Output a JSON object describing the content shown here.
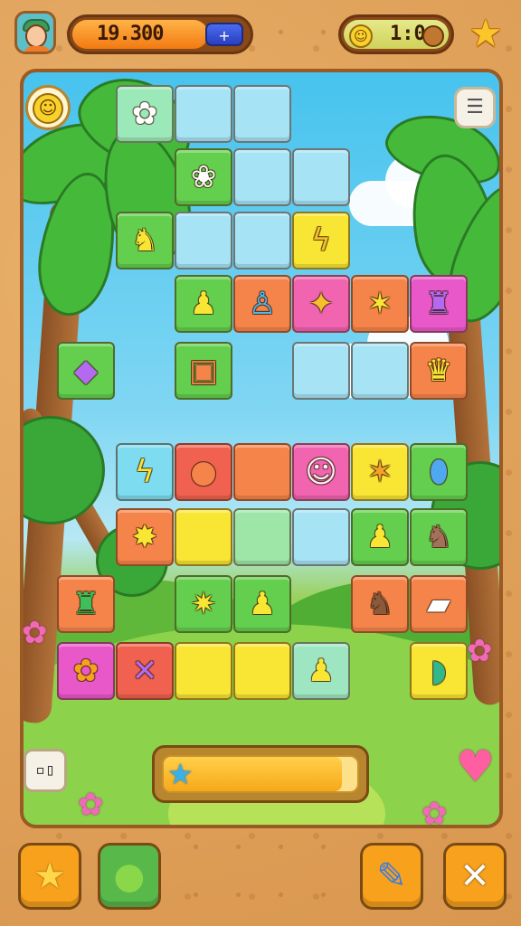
{
  "hud": {
    "score": "19.300",
    "score_add_symbol": "+",
    "timer": "1:0",
    "smile_symbol": "☺",
    "star_symbol": "★"
  },
  "controls": {
    "smiley_symbol": "☺",
    "menu_symbol": "☰",
    "tool_symbol": "▫▯",
    "progress_star_symbol": "★",
    "progress_fraction": 0.92
  },
  "bottom_bar": {
    "star_symbol": "★",
    "pet_symbol": "●",
    "pencil_symbol": "✎",
    "close_symbol": "✕"
  },
  "board": {
    "colors": {
      "green": "#64cf4e",
      "cyan": "#7ddcef",
      "yellow": "#f8e534",
      "orange": "#f5844a",
      "pink": "#f064b0",
      "magenta": "#e958c8",
      "red": "#f0624f",
      "mint": "#9ee6c2",
      "empty": "#a6e3f5"
    }
  }
}
